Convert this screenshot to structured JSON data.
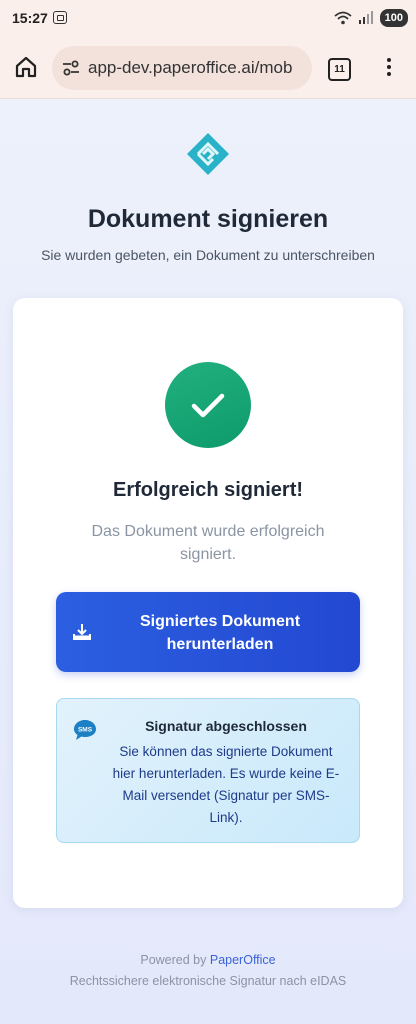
{
  "status_bar": {
    "time": "15:27",
    "battery": "100"
  },
  "browser": {
    "url": "app-dev.paperoffice.ai/mob",
    "tab_count": "11"
  },
  "header": {
    "title": "Dokument signieren",
    "subtitle": "Sie wurden gebeten, ein Dokument zu unterschreiben"
  },
  "card": {
    "success_title": "Erfolgreich signiert!",
    "success_text": "Das Dokument wurde erfolgreich signiert.",
    "download_button": "Signiertes Dokument herunterladen",
    "info": {
      "icon_label": "SMS",
      "title": "Signatur abgeschlossen",
      "text": "Sie können das signierte Dokument hier herunterladen. Es wurde keine E-Mail versendet (Signatur per SMS-Link)."
    }
  },
  "footer": {
    "powered_prefix": "Powered by",
    "brand": "PaperOffice",
    "legal": "Rechtssichere elektronische Signatur nach eIDAS"
  },
  "colors": {
    "primary": "#2348d2",
    "success": "#12a070",
    "brand_logo": "#2ab3c8"
  }
}
